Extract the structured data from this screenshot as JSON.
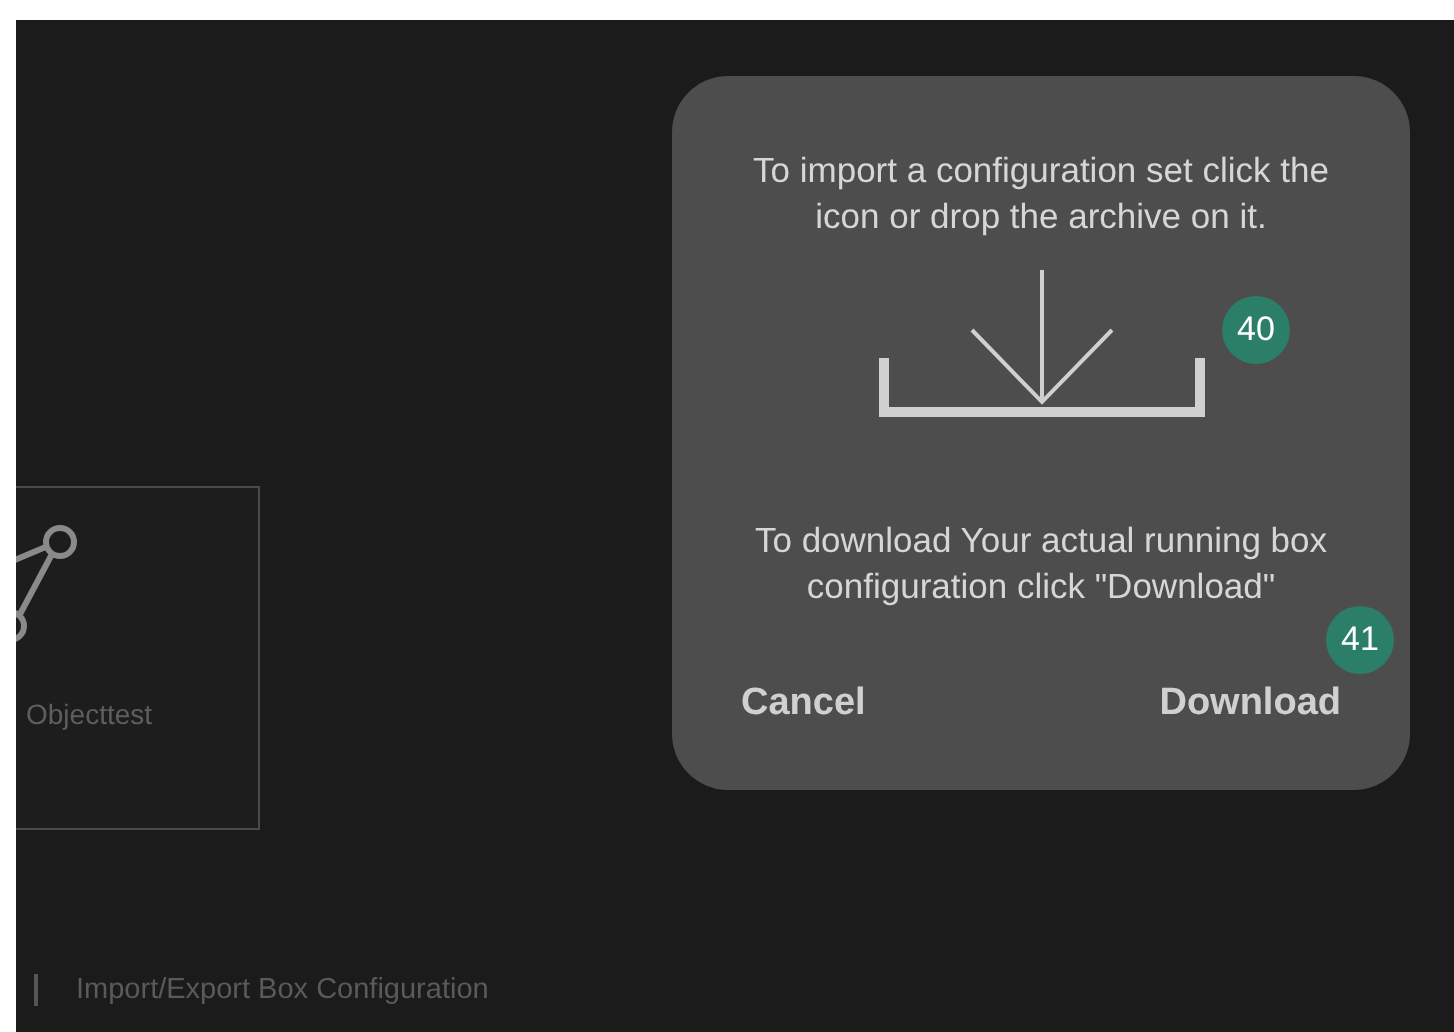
{
  "object_card": {
    "label": "Objecttest"
  },
  "footer": {
    "title": "Import/Export Box Configuration"
  },
  "dialog": {
    "import_text": "To import a configuration set click the icon or drop the archive on it.",
    "download_text": "To download Your actual running box configuration click \"Download\"",
    "cancel_button": "Cancel",
    "download_button": "Download",
    "badges": [
      {
        "label": "40"
      },
      {
        "label": "41"
      }
    ]
  }
}
